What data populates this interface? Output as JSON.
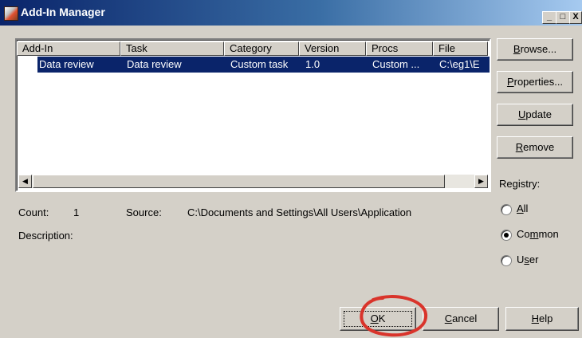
{
  "window": {
    "title": "Add-In Manager",
    "minimize": "_",
    "maximize": "□",
    "close": "X"
  },
  "list": {
    "headers": [
      "Add-In",
      "Task",
      "Category",
      "Version",
      "Procs",
      "File"
    ],
    "rows": [
      {
        "addin": "Data review",
        "task": "Data review",
        "category": "Custom task",
        "version": "1.0",
        "procs": "Custom ...",
        "file": "C:\\eg1\\E"
      }
    ]
  },
  "buttons": {
    "browse": "Browse...",
    "properties": "Properties...",
    "update": "Update",
    "remove": "Remove",
    "ok": "OK",
    "cancel": "Cancel",
    "help": "Help"
  },
  "registry": {
    "label": "Registry:",
    "options": [
      "All",
      "Common",
      "User"
    ],
    "selected": "Common"
  },
  "info": {
    "count_label": "Count:",
    "count_value": "1",
    "source_label": "Source:",
    "source_value": "C:\\Documents and Settings\\All Users\\Application",
    "description_label": "Description:"
  },
  "annotation": {
    "color": "#d9342b"
  }
}
